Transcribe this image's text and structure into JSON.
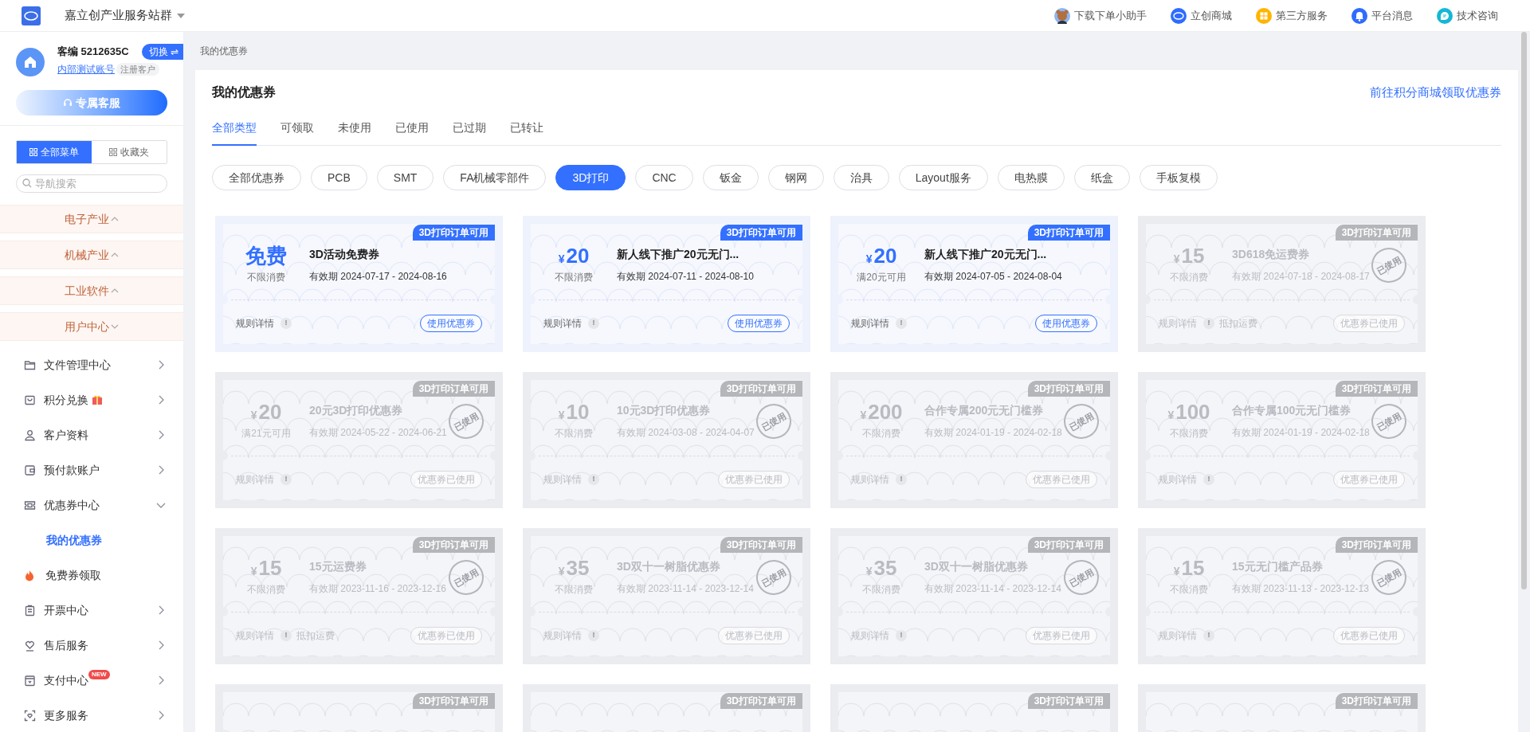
{
  "top_bar": {
    "title": "嘉立创产业服务站群",
    "links": [
      {
        "label": "下载下单小助手"
      },
      {
        "label": "立创商城"
      },
      {
        "label": "第三方服务"
      },
      {
        "label": "平台消息"
      },
      {
        "label": "技术咨询"
      }
    ]
  },
  "sidebar": {
    "account": {
      "customer_id": "客编 5212635C",
      "switch_button": "切换 ⇌",
      "account_name": "内部测试账号",
      "account_type": "注册客户"
    },
    "service_button": "专属客服",
    "menu_tabs": [
      {
        "label": "全部菜单",
        "selected": true
      },
      {
        "label": "收藏夹",
        "selected": false
      }
    ],
    "search": {
      "placeholder": "导航搜索"
    },
    "categories": [
      {
        "label": "电子产业",
        "expanded": true
      },
      {
        "label": "机械产业",
        "expanded": true
      },
      {
        "label": "工业软件",
        "expanded": true
      },
      {
        "label": "用户中心",
        "expanded": false
      }
    ],
    "items": [
      {
        "label": "文件管理中心",
        "expanded": false
      },
      {
        "label": "积分兑换",
        "expanded": false
      },
      {
        "label": "客户资料",
        "expanded": false
      },
      {
        "label": "预付款账户",
        "expanded": false
      },
      {
        "label": "优惠券中心",
        "expanded": true,
        "children": [
          {
            "label": "我的优惠券",
            "selected": true
          },
          {
            "label": "免费券领取",
            "selected": false
          }
        ]
      },
      {
        "label": "开票中心",
        "expanded": false
      },
      {
        "label": "售后服务",
        "expanded": false
      },
      {
        "label": "支付中心",
        "badge": "NEW",
        "expanded": false
      },
      {
        "label": "更多服务",
        "expanded": false
      }
    ]
  },
  "breadcrumb": "我的优惠券",
  "panel": {
    "title": "我的优惠券",
    "link": "前往积分商城领取优惠券",
    "tabs": [
      {
        "label": "全部类型",
        "selected": true
      },
      {
        "label": "可领取",
        "selected": false
      },
      {
        "label": "未使用",
        "selected": false
      },
      {
        "label": "已使用",
        "selected": false
      },
      {
        "label": "已过期",
        "selected": false
      },
      {
        "label": "已转让",
        "selected": false
      }
    ],
    "filters": [
      {
        "label": "全部优惠券",
        "selected": false
      },
      {
        "label": "PCB",
        "selected": false
      },
      {
        "label": "SMT",
        "selected": false
      },
      {
        "label": "FA机械零部件",
        "selected": false
      },
      {
        "label": "3D打印",
        "selected": true
      },
      {
        "label": "CNC",
        "selected": false
      },
      {
        "label": "钣金",
        "selected": false
      },
      {
        "label": "钢网",
        "selected": false
      },
      {
        "label": "治具",
        "selected": false
      },
      {
        "label": "Layout服务",
        "selected": false
      },
      {
        "label": "电热膜",
        "selected": false
      },
      {
        "label": "纸盒",
        "selected": false
      },
      {
        "label": "手板复模",
        "selected": false
      }
    ],
    "coupons": [
      {
        "tag": "3D打印订单可用",
        "used": false,
        "amount": "免费",
        "condition": "不限消费",
        "title": "3D活动免费券",
        "validity": "有效期 2024-07-17 - 2024-08-16",
        "rules": "规则详情",
        "info": "!",
        "action": "使用优惠券"
      },
      {
        "tag": "3D打印订单可用",
        "used": false,
        "currency": "¥",
        "amount": "20",
        "condition": "不限消费",
        "title": "新人线下推广20元无门...",
        "validity": "有效期 2024-07-11 - 2024-08-10",
        "rules": "规则详情",
        "info": "!",
        "action": "使用优惠券"
      },
      {
        "tag": "3D打印订单可用",
        "used": false,
        "currency": "¥",
        "amount": "20",
        "condition": "满20元可用",
        "title": "新人线下推广20元无门...",
        "validity": "有效期 2024-07-05 - 2024-08-04",
        "rules": "规则详情",
        "info": "!",
        "action": "使用优惠券"
      },
      {
        "tag": "3D打印订单可用",
        "used": true,
        "stamp": "已使用",
        "currency": "¥",
        "amount": "15",
        "condition": "不限消费",
        "title": "3D618免运费券",
        "validity": "有效期 2024-07-18 - 2024-08-17",
        "rules": "规则详情",
        "info": "!",
        "note": "抵扣运费",
        "action": "优惠券已使用"
      },
      {
        "tag": "3D打印订单可用",
        "used": true,
        "stamp": "已使用",
        "currency": "¥",
        "amount": "20",
        "condition": "满21元可用",
        "title": "20元3D打印优惠券",
        "validity": "有效期 2024-05-22 - 2024-06-21",
        "rules": "规则详情",
        "info": "!",
        "action": "优惠券已使用"
      },
      {
        "tag": "3D打印订单可用",
        "used": true,
        "stamp": "已使用",
        "currency": "¥",
        "amount": "10",
        "condition": "不限消费",
        "title": "10元3D打印优惠券",
        "validity": "有效期 2024-03-08 - 2024-04-07",
        "rules": "规则详情",
        "info": "!",
        "action": "优惠券已使用"
      },
      {
        "tag": "3D打印订单可用",
        "used": true,
        "stamp": "已使用",
        "currency": "¥",
        "amount": "200",
        "condition": "不限消费",
        "title": "合作专属200元无门槛券",
        "validity": "有效期 2024-01-19 - 2024-02-18",
        "rules": "规则详情",
        "info": "!",
        "action": "优惠券已使用"
      },
      {
        "tag": "3D打印订单可用",
        "used": true,
        "stamp": "已使用",
        "currency": "¥",
        "amount": "100",
        "condition": "不限消费",
        "title": "合作专属100元无门槛券",
        "validity": "有效期 2024-01-19 - 2024-02-18",
        "rules": "规则详情",
        "info": "!",
        "action": "优惠券已使用"
      },
      {
        "tag": "3D打印订单可用",
        "used": true,
        "stamp": "已使用",
        "currency": "¥",
        "amount": "15",
        "condition": "不限消费",
        "title": "15元运费券",
        "validity": "有效期 2023-11-16 - 2023-12-16",
        "rules": "规则详情",
        "info": "!",
        "note": "抵扣运费",
        "action": "优惠券已使用"
      },
      {
        "tag": "3D打印订单可用",
        "used": true,
        "stamp": "已使用",
        "currency": "¥",
        "amount": "35",
        "condition": "不限消费",
        "title": "3D双十一树脂优惠券",
        "validity": "有效期 2023-11-14 - 2023-12-14",
        "rules": "规则详情",
        "info": "!",
        "action": "优惠券已使用"
      },
      {
        "tag": "3D打印订单可用",
        "used": true,
        "stamp": "已使用",
        "currency": "¥",
        "amount": "35",
        "condition": "不限消费",
        "title": "3D双十一树脂优惠券",
        "validity": "有效期 2023-11-14 - 2023-12-14",
        "rules": "规则详情",
        "info": "!",
        "action": "优惠券已使用"
      },
      {
        "tag": "3D打印订单可用",
        "used": true,
        "stamp": "已使用",
        "currency": "¥",
        "amount": "15",
        "condition": "不限消费",
        "title": "15元无门槛产品券",
        "validity": "有效期 2023-11-13 - 2023-12-13",
        "rules": "规则详情",
        "info": "!",
        "action": "优惠券已使用"
      },
      {
        "tag": "3D打印订单可用",
        "used": true
      },
      {
        "tag": "3D打印订单可用",
        "used": true
      },
      {
        "tag": "3D打印订单可用",
        "used": true
      },
      {
        "tag": "3D打印订单可用",
        "used": true
      }
    ]
  }
}
